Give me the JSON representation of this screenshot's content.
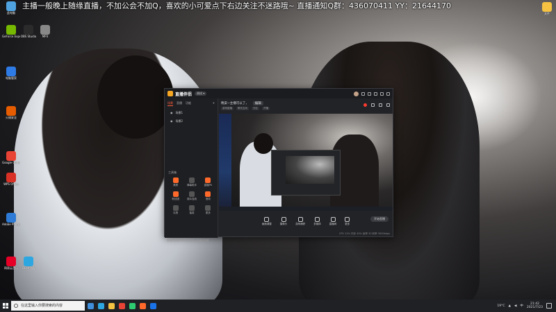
{
  "banner": "主播一般晚上随缘直播，不加公会不加Q，喜欢的小可爱点下右边关注不迷路哦~ 直播通知Q群：436070411  YY：21644170",
  "desktop_icons": [
    {
      "label": "此电脑",
      "color": "#4fa3e0"
    },
    {
      "label": "GeForce Experience",
      "color": "#76b900"
    },
    {
      "label": "OBS Studio",
      "color": "#2b2b2b"
    },
    {
      "label": "MP3",
      "color": "#888888"
    },
    {
      "label": "电脑管家",
      "color": "#2e7be6"
    },
    {
      "label": "火绒安全",
      "color": "#e65c00"
    },
    {
      "label": "Google Chrome",
      "color": "#e84335"
    },
    {
      "label": "WPS Office",
      "color": "#d93025"
    },
    {
      "label": "Adobe Photoshop",
      "color": "#2d7bd6"
    },
    {
      "label": "网易云音乐",
      "color": "#e60026"
    },
    {
      "label": "QQ浏览器",
      "color": "#2ea7e0"
    },
    {
      "label": "文件",
      "color": "#f5c242"
    }
  ],
  "app": {
    "name": "直播伴侣",
    "version": "测试 ▾",
    "left_tabs": [
      "场景",
      "直播",
      "功能"
    ],
    "left_add": "+",
    "scenes": [
      "场景1",
      "场景2"
    ],
    "tools_label": "工具箱",
    "tools": [
      {
        "label": "美颜",
        "accent": true
      },
      {
        "label": "弹幕助手",
        "accent": false
      },
      {
        "label": "直播PK",
        "accent": true
      },
      {
        "label": "粉丝团",
        "accent": true
      },
      {
        "label": "观众连线",
        "accent": false
      },
      {
        "label": "音效",
        "accent": true
      },
      {
        "label": "礼物",
        "accent": false
      },
      {
        "label": "抽奖",
        "accent": false
      },
      {
        "label": "更多",
        "accent": false
      }
    ],
    "left_notice": "直播伴侣实时精彩 点击进入直播间查看",
    "room_title": "晚安~主播可以了，",
    "room_button": "编辑",
    "room_tags": [
      "游戏直播",
      "聊天互动",
      "分区",
      "开播"
    ],
    "bottom_buttons": [
      "画面调整",
      "摄像头",
      "游戏捕获",
      "多媒体",
      "直播间",
      "更多"
    ],
    "start_label": "开始直播",
    "status_line": "CPU 12%  内存 45%  帧率 30  码率 3000kbps"
  },
  "taskbar": {
    "search_placeholder": "在这里输入你要搜索的内容",
    "apps": [
      "#3f8fdc",
      "#2ea7e0",
      "#f5c242",
      "#e84335",
      "#2ecc71",
      "#ff6a2b",
      "#1a73e8"
    ],
    "weather": "19°C",
    "ime": "中",
    "time": "21:42",
    "date": "2021/7/23"
  }
}
